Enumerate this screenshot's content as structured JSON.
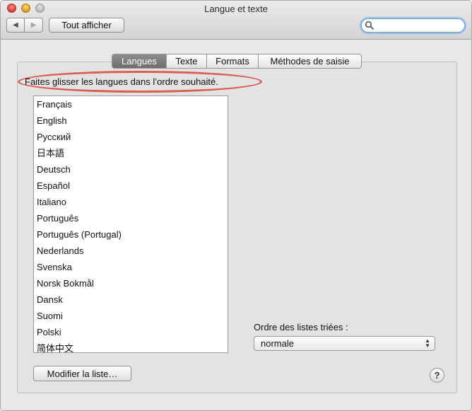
{
  "window": {
    "title": "Langue et texte"
  },
  "toolbar": {
    "back_icon": "◀",
    "forward_icon": "▶",
    "show_all_label": "Tout afficher",
    "search": {
      "placeholder": "",
      "value": ""
    }
  },
  "tabs": [
    {
      "label": "Langues",
      "selected": true
    },
    {
      "label": "Texte",
      "selected": false
    },
    {
      "label": "Formats",
      "selected": false
    },
    {
      "label": "Méthodes de saisie",
      "selected": false
    }
  ],
  "languages_pane": {
    "hint": "Faites glisser les langues dans l’ordre souhaité.",
    "languages": [
      "Français",
      "English",
      "Русский",
      "日本語",
      "Deutsch",
      "Español",
      "Italiano",
      "Português",
      "Português (Portugal)",
      "Nederlands",
      "Svenska",
      "Norsk Bokmål",
      "Dansk",
      "Suomi",
      "Polski",
      "简体中文"
    ],
    "sort_order_label": "Ordre des listes triées :",
    "sort_order_value": "normale",
    "modify_list_label": "Modifier la liste…",
    "help_label": "?"
  },
  "colors": {
    "annotation_ellipse": "#d94f3d",
    "search_focus": "#7db1e8",
    "selected_tab": "#7a7a7a"
  }
}
